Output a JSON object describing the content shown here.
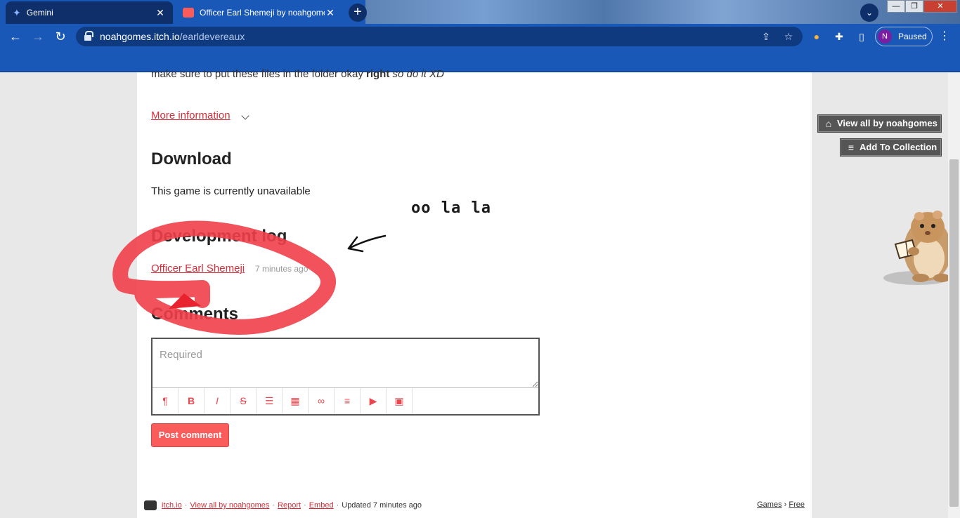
{
  "browser": {
    "tabs": [
      {
        "title": "Gemini"
      },
      {
        "title": "Officer Earl Shemeji by noahgomes"
      }
    ],
    "url_host": "noahgomes.itch.io",
    "url_path": "/earldevereaux",
    "profile_initial": "N",
    "profile_status": "Paused"
  },
  "page": {
    "partial_text_plain": "make sure to put these files in the folder okay ",
    "partial_text_bold": "right",
    "partial_text_italic": " so do it XD",
    "more_info": "More information",
    "download_heading": "Download",
    "unavailable_text": "This game is currently unavailable",
    "annotation_text": "oo la la",
    "devlog_heading": "Development log",
    "devlog_entry": {
      "title": "Officer Earl Shemeji",
      "time": "7 minutes ago"
    },
    "comments_heading": "Comments",
    "comment_placeholder": "Required",
    "post_button": "Post comment"
  },
  "editor_buttons": [
    {
      "name": "paragraph",
      "glyph": "¶"
    },
    {
      "name": "bold",
      "glyph": "B"
    },
    {
      "name": "italic",
      "glyph": "I"
    },
    {
      "name": "strikethrough",
      "glyph": "S"
    },
    {
      "name": "bulleted-list",
      "glyph": "☰"
    },
    {
      "name": "table",
      "glyph": "▦"
    },
    {
      "name": "link",
      "glyph": "∞"
    },
    {
      "name": "align",
      "glyph": "≡"
    },
    {
      "name": "youtube",
      "glyph": "▶"
    },
    {
      "name": "image",
      "glyph": "▣"
    }
  ],
  "sidebar": {
    "view_all": "View all by noahgomes",
    "add_collection": "Add To Collection"
  },
  "footer": {
    "itchio": "itch.io",
    "view_all": "View all by noahgomes",
    "report": "Report",
    "embed": "Embed",
    "updated": "Updated 7 minutes ago",
    "games": "Games",
    "sep": "›",
    "free": "Free"
  },
  "colors": {
    "browser_blue": "#1a58b8",
    "itch_red": "#fa5c5c",
    "link_red": "#da2c38",
    "scribble_red": "#ef3f4a"
  }
}
